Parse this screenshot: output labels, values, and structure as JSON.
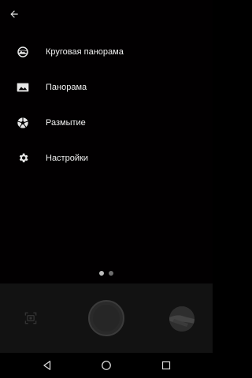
{
  "menu": {
    "items": [
      {
        "label": "Круговая панорама",
        "icon": "photosphere-icon"
      },
      {
        "label": "Панорама",
        "icon": "panorama-icon"
      },
      {
        "label": "Размытие",
        "icon": "lens-blur-icon"
      },
      {
        "label": "Настройки",
        "icon": "settings-gear-icon"
      }
    ]
  },
  "pager": {
    "count": 2,
    "active_index": 0
  },
  "colors": {
    "background": "#000000",
    "menu_text": "#f2f2f2",
    "controls_bar": "#121212",
    "pager_active": "#bdbdbd",
    "pager_inactive": "#6d6d6d"
  }
}
